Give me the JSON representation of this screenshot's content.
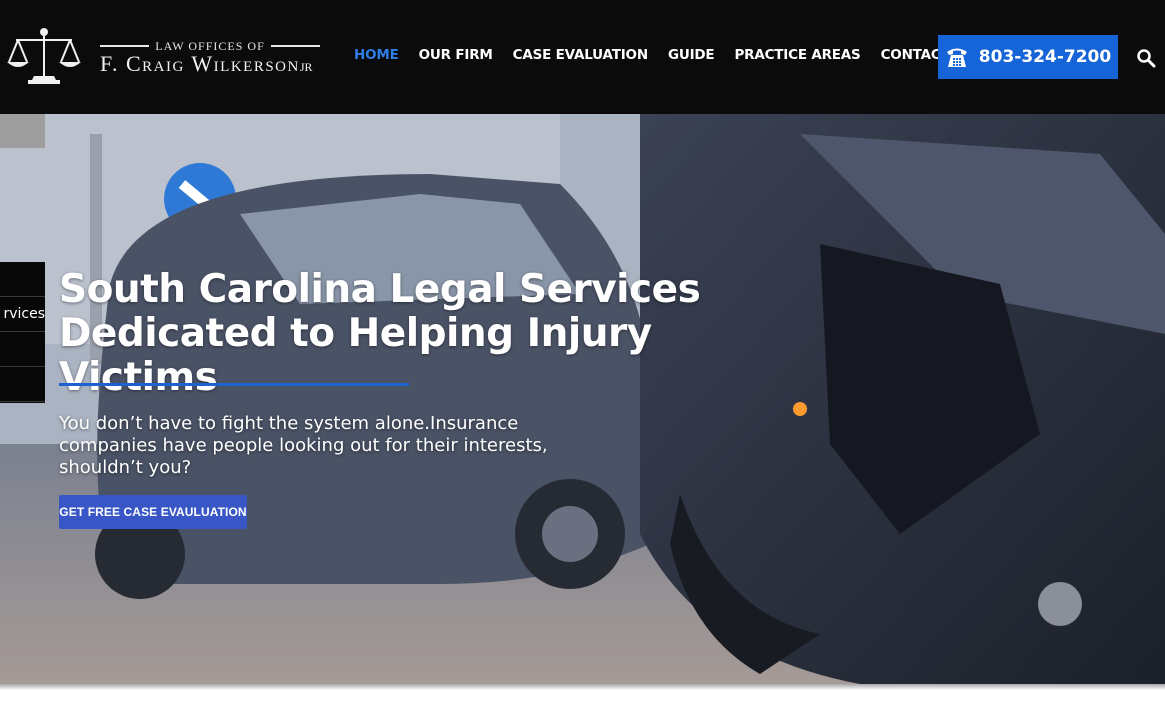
{
  "header": {
    "logo": {
      "top_line": "LAW OFFICES OF",
      "name": "F. Craig Wilkerson",
      "suffix": "JR",
      "icon": "scales-of-justice-icon"
    },
    "nav": [
      {
        "label": "HOME",
        "active": true
      },
      {
        "label": "OUR FIRM",
        "active": false
      },
      {
        "label": "CASE EVALUATION",
        "active": false
      },
      {
        "label": "GUIDE",
        "active": false
      },
      {
        "label": "PRACTICE AREAS",
        "active": false
      },
      {
        "label": "CONTACT",
        "active": false
      }
    ],
    "phone": {
      "number": "803-324-7200",
      "icon": "phone-icon"
    },
    "search_icon": "search-icon"
  },
  "side_panel": {
    "rows": [
      "",
      "rvices",
      "",
      ""
    ]
  },
  "hero": {
    "headline_line1": "South Carolina Legal Services",
    "headline_line2": "Dedicated to Helping Injury Victims",
    "subtext": "You don’t have to fight the system alone.Insurance companies have people looking out for their interests, shouldn’t you?",
    "cta_label": "GET FREE CASE EVAULUATION"
  },
  "colors": {
    "header_bg": "#0b0b0b",
    "nav_active": "#2d7ee6",
    "phone_button": "#1565d8",
    "cta_button": "#3856c6",
    "headline_rule": "#1e62d0"
  }
}
